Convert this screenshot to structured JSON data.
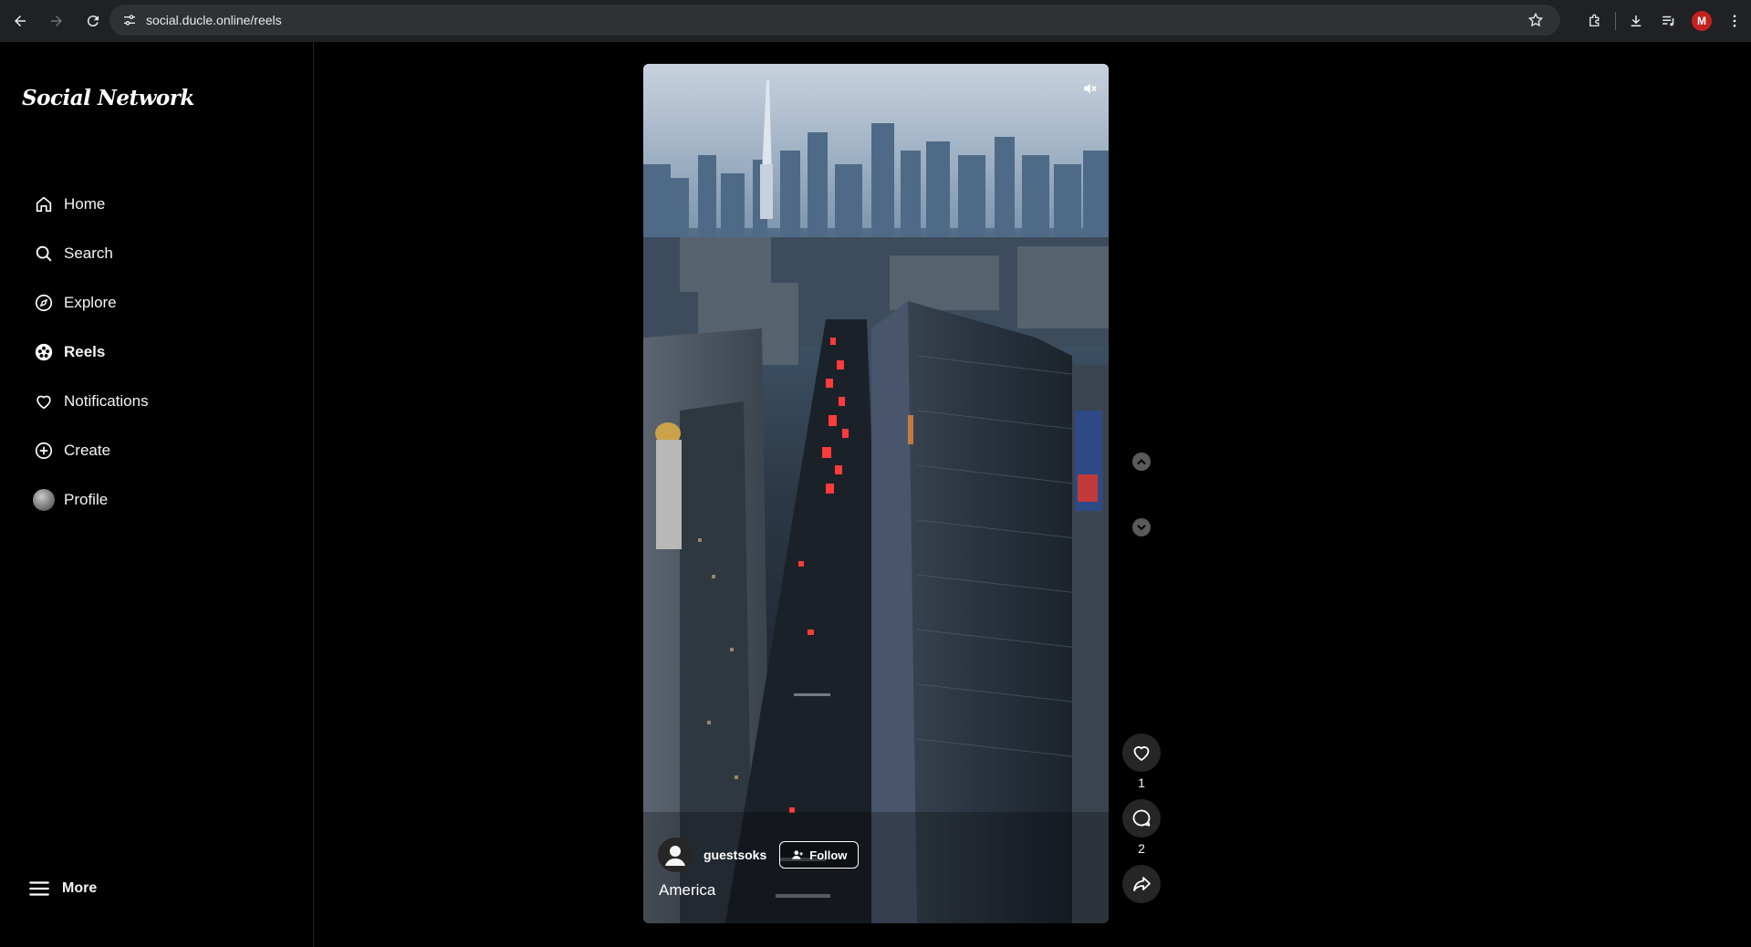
{
  "browser": {
    "url": "social.ducle.online/reels",
    "profile_initial": "M"
  },
  "sidebar": {
    "logo": "Social Network",
    "items": [
      {
        "label": "Home",
        "icon": "home-icon"
      },
      {
        "label": "Search",
        "icon": "search-icon"
      },
      {
        "label": "Explore",
        "icon": "compass-icon"
      },
      {
        "label": "Reels",
        "icon": "reels-icon",
        "active": true
      },
      {
        "label": "Notifications",
        "icon": "heart-icon"
      },
      {
        "label": "Create",
        "icon": "plus-circle-icon"
      },
      {
        "label": "Profile",
        "icon": "avatar"
      }
    ],
    "more_label": "More"
  },
  "reel": {
    "author": "guestsoks",
    "follow_label": "Follow",
    "caption": "America",
    "likes": "1",
    "comments": "2"
  },
  "colors": {
    "background": "#000000",
    "chrome": "#202124",
    "omnibox": "#303134",
    "action_button": "#262626",
    "profile_badge": "#c5221f"
  }
}
